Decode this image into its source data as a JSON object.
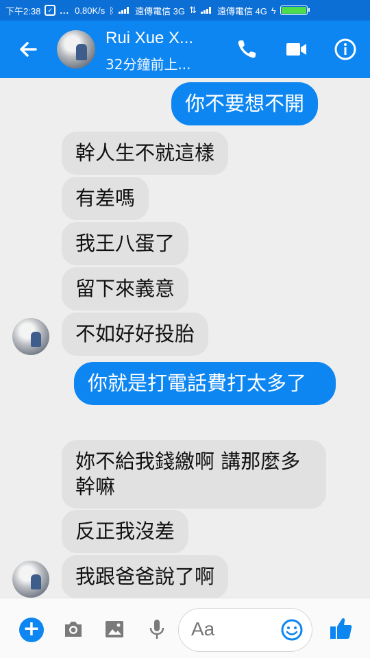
{
  "status_bar": {
    "time": "下午2:38",
    "dots": "...",
    "speed": "0.80K/s",
    "carrier1": "遠傳電信 3G",
    "carrier2": "遠傳電信 4G",
    "battery_level": 1.0
  },
  "header": {
    "contact_name": "Rui Xue X...",
    "status": "32分鐘前上..."
  },
  "messages": [
    {
      "side": "out",
      "text": "你不要想不開"
    },
    {
      "side": "in",
      "text": "幹人生不就這樣"
    },
    {
      "side": "in",
      "text": "有差嗎"
    },
    {
      "side": "in",
      "text": "我王八蛋了"
    },
    {
      "side": "in",
      "text": "留下來義意"
    },
    {
      "side": "in",
      "text": "不如好好投胎"
    },
    {
      "side": "out",
      "text": "你就是打電話費打太多了"
    },
    {
      "side": "in",
      "text": "妳不給我錢繳啊 講那麼多幹嘛"
    },
    {
      "side": "in",
      "text": "反正我沒差"
    },
    {
      "side": "in",
      "text": "我跟爸爸說了啊"
    }
  ],
  "composer": {
    "placeholder": "Aa",
    "plus_symbol": "+"
  },
  "colors": {
    "brand_blue": "#0d86f2",
    "status_blue": "#0b6fd6",
    "incoming_bubble": "#e1e1e1",
    "chat_background": "#eeeeee"
  }
}
